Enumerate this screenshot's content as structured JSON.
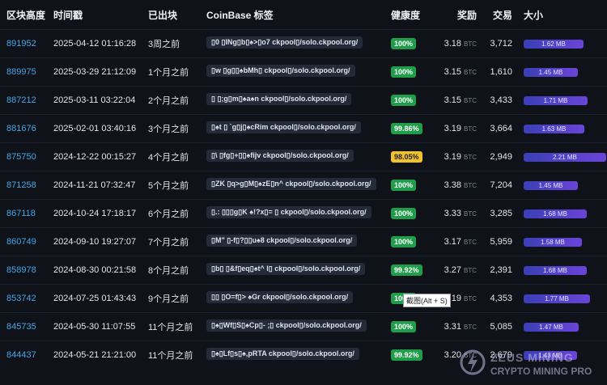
{
  "headers": {
    "height": "区块高度",
    "time": "时间戳",
    "age": "已出块",
    "coinbase": "CoinBase 标签",
    "health": "健康度",
    "reward": "奖励",
    "tx": "交易",
    "size": "大小"
  },
  "btc_unit": "BTC",
  "rows": [
    {
      "height": "891952",
      "time": "2025-04-12 01:16:28",
      "age": "3周之前",
      "coinbase": "▯0 ▯INg▯b▯♠>▯o7 ckpool▯/solo.ckpool.org/",
      "health": "100%",
      "health_color": "#1f9d4a",
      "reward": "3.18",
      "tx": "3,712",
      "size": "1.62 MB",
      "size_fraction": 0.73
    },
    {
      "height": "889975",
      "time": "2025-03-29 21:12:09",
      "age": "1个月之前",
      "coinbase": "▯w ▯g▯▯♠bMh▯ ckpool▯/solo.ckpool.org/",
      "health": "100%",
      "health_color": "#1f9d4a",
      "reward": "3.15",
      "tx": "1,610",
      "size": "1.45 MB",
      "size_fraction": 0.66
    },
    {
      "height": "887212",
      "time": "2025-03-11 03:22:04",
      "age": "2个月之前",
      "coinbase": "▯ ▯;g▯m▯♠a♠n  ckpool▯/solo.ckpool.org/",
      "health": "100%",
      "health_color": "#1f9d4a",
      "reward": "3.15",
      "tx": "3,433",
      "size": "1.71 MB",
      "size_fraction": 0.77
    },
    {
      "height": "881676",
      "time": "2025-02-01 03:40:16",
      "age": "3个月之前",
      "coinbase": "▯♠t ▯ `g▯j▯♠cRim ckpool▯/solo.ckpool.org/",
      "health": "99.86%",
      "health_color": "#1f9d4a",
      "reward": "3.19",
      "tx": "3,664",
      "size": "1.63 MB",
      "size_fraction": 0.74
    },
    {
      "height": "875750",
      "time": "2024-12-22 00:15:27",
      "age": "4个月之前",
      "coinbase": "▯\\ ▯fg▯+▯▯♠fijv ckpool▯/solo.ckpool.org/",
      "health": "98.05%",
      "health_color": "#f2c12e",
      "reward": "3.19",
      "tx": "2,949",
      "size": "2.21 MB",
      "size_fraction": 1.0
    },
    {
      "height": "871258",
      "time": "2024-11-21 07:32:47",
      "age": "5个月之前",
      "coinbase": "▯ZK ▯q>g▯M▯♠zE▯n^ ckpool▯/solo.ckpool.org/",
      "health": "100%",
      "health_color": "#1f9d4a",
      "reward": "3.38",
      "tx": "7,204",
      "size": "1.45 MB",
      "size_fraction": 0.66
    },
    {
      "height": "867118",
      "time": "2024-10-24 17:18:17",
      "age": "6个月之前",
      "coinbase": "▯.: ▯▯▯g▯K ♠!?x▯= ▯ ckpool▯/solo.ckpool.org/",
      "health": "100%",
      "health_color": "#1f9d4a",
      "reward": "3.33",
      "tx": "3,285",
      "size": "1.68 MB",
      "size_fraction": 0.76
    },
    {
      "height": "860749",
      "time": "2024-09-10 19:27:07",
      "age": "7个月之前",
      "coinbase": "▯M\" ▯-f▯?▯▯u♠8 ckpool▯/solo.ckpool.org/",
      "health": "100%",
      "health_color": "#1f9d4a",
      "reward": "3.17",
      "tx": "5,959",
      "size": "1.58 MB",
      "size_fraction": 0.71
    },
    {
      "height": "858978",
      "time": "2024-08-30 00:21:58",
      "age": "8个月之前",
      "coinbase": "▯b▯ ▯&f▯eq▯♠t^ l▯ ckpool▯/solo.ckpool.org/",
      "health": "99.92%",
      "health_color": "#1f9d4a",
      "reward": "3.27",
      "tx": "2,391",
      "size": "1.68 MB",
      "size_fraction": 0.76
    },
    {
      "height": "853742",
      "time": "2024-07-25 01:43:43",
      "age": "9个月之前",
      "coinbase": "▯▯ ▯O=f▯> ♠Gr ckpool▯/solo.ckpool.org/",
      "health": "100%",
      "health_color": "#1f9d4a",
      "reward": "3.19",
      "tx": "4,353",
      "size": "1.77 MB",
      "size_fraction": 0.8
    },
    {
      "height": "845735",
      "time": "2024-05-30 11:07:55",
      "age": "11个月之前",
      "coinbase": "▯♠▯Wf▯S▯♠Cp▯- ;▯ ckpool▯/solo.ckpool.org/",
      "health": "100%",
      "health_color": "#1f9d4a",
      "reward": "3.31",
      "tx": "5,085",
      "size": "1.47 MB",
      "size_fraction": 0.67
    },
    {
      "height": "844437",
      "time": "2024-05-21 21:21:00",
      "age": "11个月之前",
      "coinbase": "▯♠▯Lf▯s▯♠,pRTA ckpool▯/solo.ckpool.org/",
      "health": "99.92%",
      "health_color": "#1f9d4a",
      "reward": "3.20",
      "tx": "2,679",
      "size": "1.43 MB",
      "size_fraction": 0.65
    }
  ],
  "tooltip": "截图(Alt + S)",
  "watermark": {
    "name": "ZEUS MINING",
    "sub": "CRYPTO MINING PRO"
  }
}
